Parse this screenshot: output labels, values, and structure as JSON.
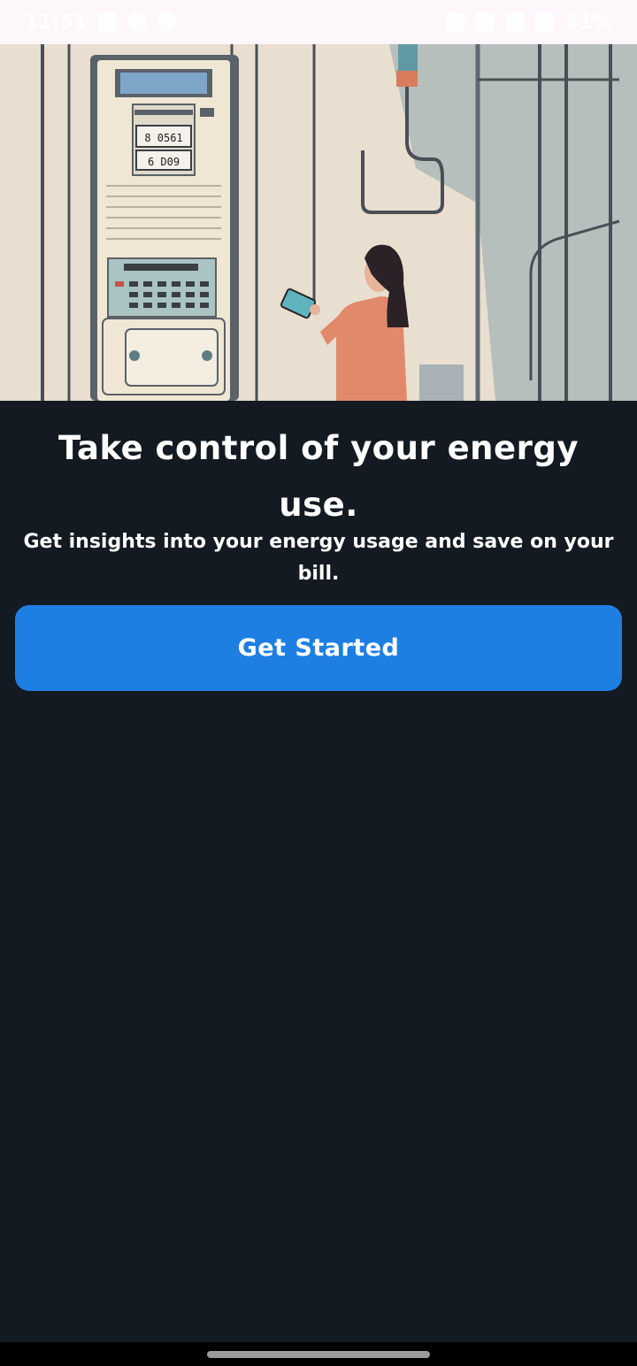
{
  "status_bar": {
    "time": "11:51",
    "battery": "41%"
  },
  "hero": {
    "meter_reading_top": "8 0561",
    "meter_reading_bottom": "6 D09"
  },
  "onboarding": {
    "headline": "Take control of your energy use.",
    "subtitle": "Get insights into your energy usage and save on your bill.",
    "cta_label": "Get Started"
  },
  "colors": {
    "background": "#131a22",
    "accent": "#1e7fe3",
    "text": "#ffffff"
  }
}
